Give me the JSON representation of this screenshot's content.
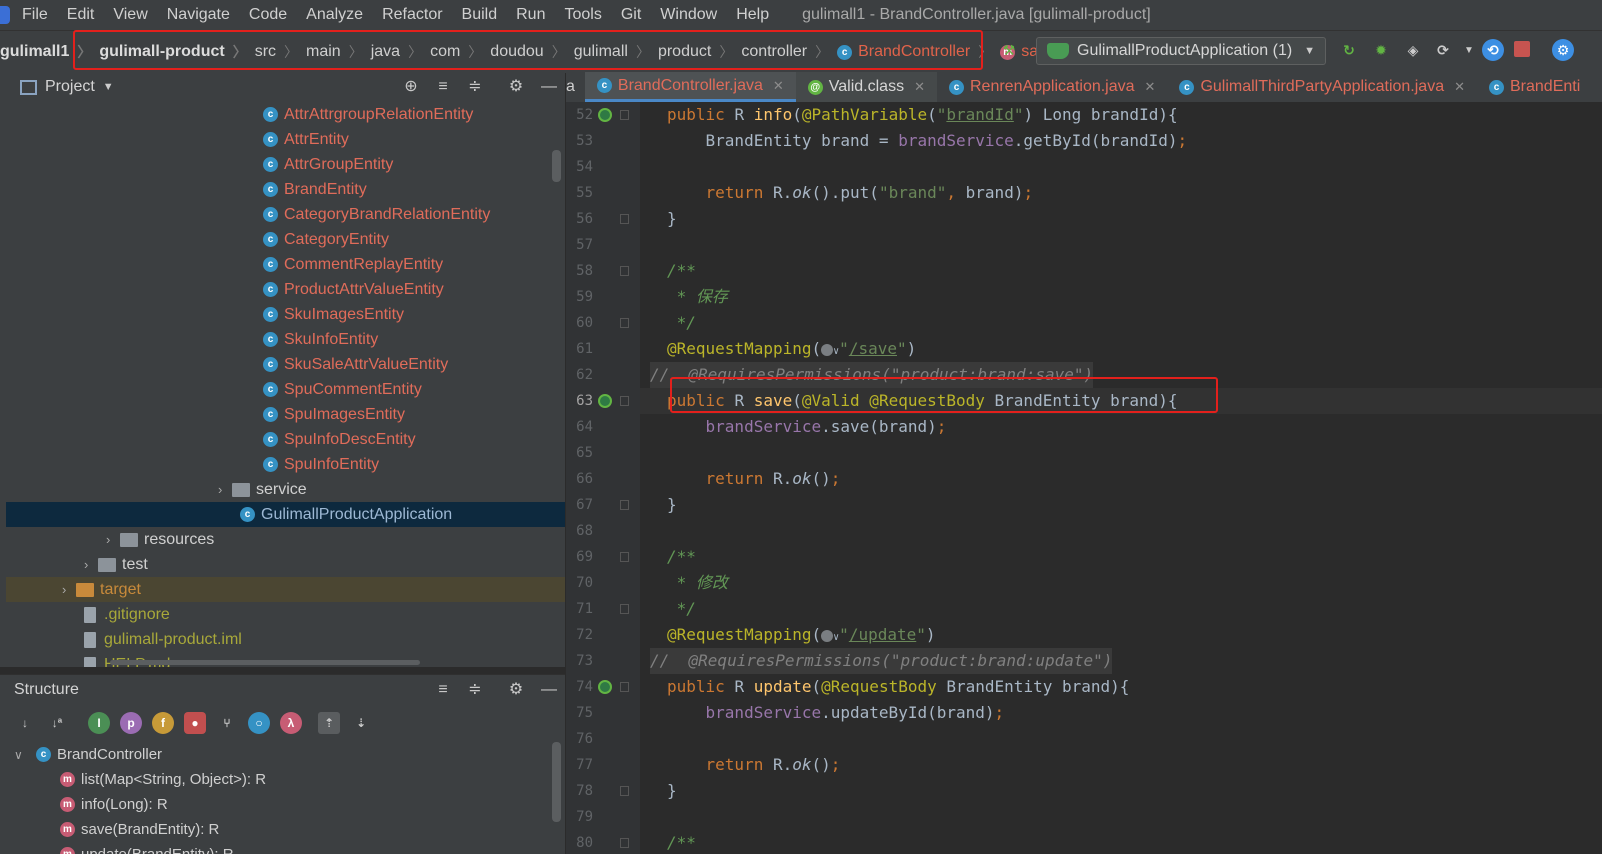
{
  "window": {
    "title": "gulimall1 - BrandController.java [gulimall-product]",
    "menu": [
      "File",
      "Edit",
      "View",
      "Navigate",
      "Code",
      "Analyze",
      "Refactor",
      "Build",
      "Run",
      "Tools",
      "Git",
      "Window",
      "Help"
    ]
  },
  "breadcrumb": {
    "items": [
      "gulimall1",
      "gulimall-product",
      "src",
      "main",
      "java",
      "com",
      "doudou",
      "gulimall",
      "product",
      "controller",
      "BrandController",
      "save"
    ]
  },
  "run_config": {
    "label": "GulimallProductApplication (1)"
  },
  "project_panel": {
    "title": "Project",
    "tree": [
      {
        "label": "AttrAttrgroupRelationEntity",
        "kind": "class"
      },
      {
        "label": "AttrEntity",
        "kind": "class"
      },
      {
        "label": "AttrGroupEntity",
        "kind": "class"
      },
      {
        "label": "BrandEntity",
        "kind": "class"
      },
      {
        "label": "CategoryBrandRelationEntity",
        "kind": "class"
      },
      {
        "label": "CategoryEntity",
        "kind": "class"
      },
      {
        "label": "CommentReplayEntity",
        "kind": "class"
      },
      {
        "label": "ProductAttrValueEntity",
        "kind": "class"
      },
      {
        "label": "SkuImagesEntity",
        "kind": "class"
      },
      {
        "label": "SkuInfoEntity",
        "kind": "class"
      },
      {
        "label": "SkuSaleAttrValueEntity",
        "kind": "class"
      },
      {
        "label": "SpuCommentEntity",
        "kind": "class"
      },
      {
        "label": "SpuImagesEntity",
        "kind": "class"
      },
      {
        "label": "SpuInfoDescEntity",
        "kind": "class"
      },
      {
        "label": "SpuInfoEntity",
        "kind": "class"
      },
      {
        "label": "service",
        "kind": "package"
      },
      {
        "label": "GulimallProductApplication",
        "kind": "app"
      },
      {
        "label": "resources",
        "kind": "folder"
      },
      {
        "label": "test",
        "kind": "folder"
      },
      {
        "label": "target",
        "kind": "folder-orange"
      },
      {
        "label": ".gitignore",
        "kind": "file"
      },
      {
        "label": "gulimall-product.iml",
        "kind": "file"
      },
      {
        "label": "HELP.md",
        "kind": "file"
      }
    ]
  },
  "structure_panel": {
    "title": "Structure",
    "root": "BrandController",
    "members": [
      "list(Map<String, Object>): R",
      "info(Long): R",
      "save(BrandEntity): R",
      "update(BrandEntity): R"
    ]
  },
  "tabs": [
    {
      "label": "a"
    },
    {
      "label": "BrandController.java",
      "active": true
    },
    {
      "label": "Valid.class"
    },
    {
      "label": "RenrenApplication.java"
    },
    {
      "label": "GulimallThirdPartyApplication.java"
    },
    {
      "label": "BrandEnti"
    }
  ],
  "editor": {
    "line_numbers": [
      "52",
      "53",
      "54",
      "55",
      "56",
      "57",
      "58",
      "59",
      "60",
      "61",
      "62",
      "63",
      "64",
      "65",
      "66",
      "67",
      "68",
      "69",
      "70",
      "71",
      "72",
      "73",
      "74",
      "75",
      "76",
      "77",
      "78",
      "79",
      "80"
    ],
    "strings": {
      "brandId": "brandId",
      "brand": "brand",
      "save_path": "/save",
      "update_path": "/update",
      "perm_save": "\"product:brand:save\"",
      "perm_update": "\"product:brand:update\"",
      "doc_save": " * 保存",
      "doc_update": " * 修改"
    }
  },
  "colors": {
    "highlight_red": "#e3201c",
    "keyword": "#cc7832",
    "annotation": "#bbb529",
    "string": "#6a8759",
    "method": "#ffc66d",
    "field": "#9876aa",
    "error_red": "#e0634a"
  }
}
